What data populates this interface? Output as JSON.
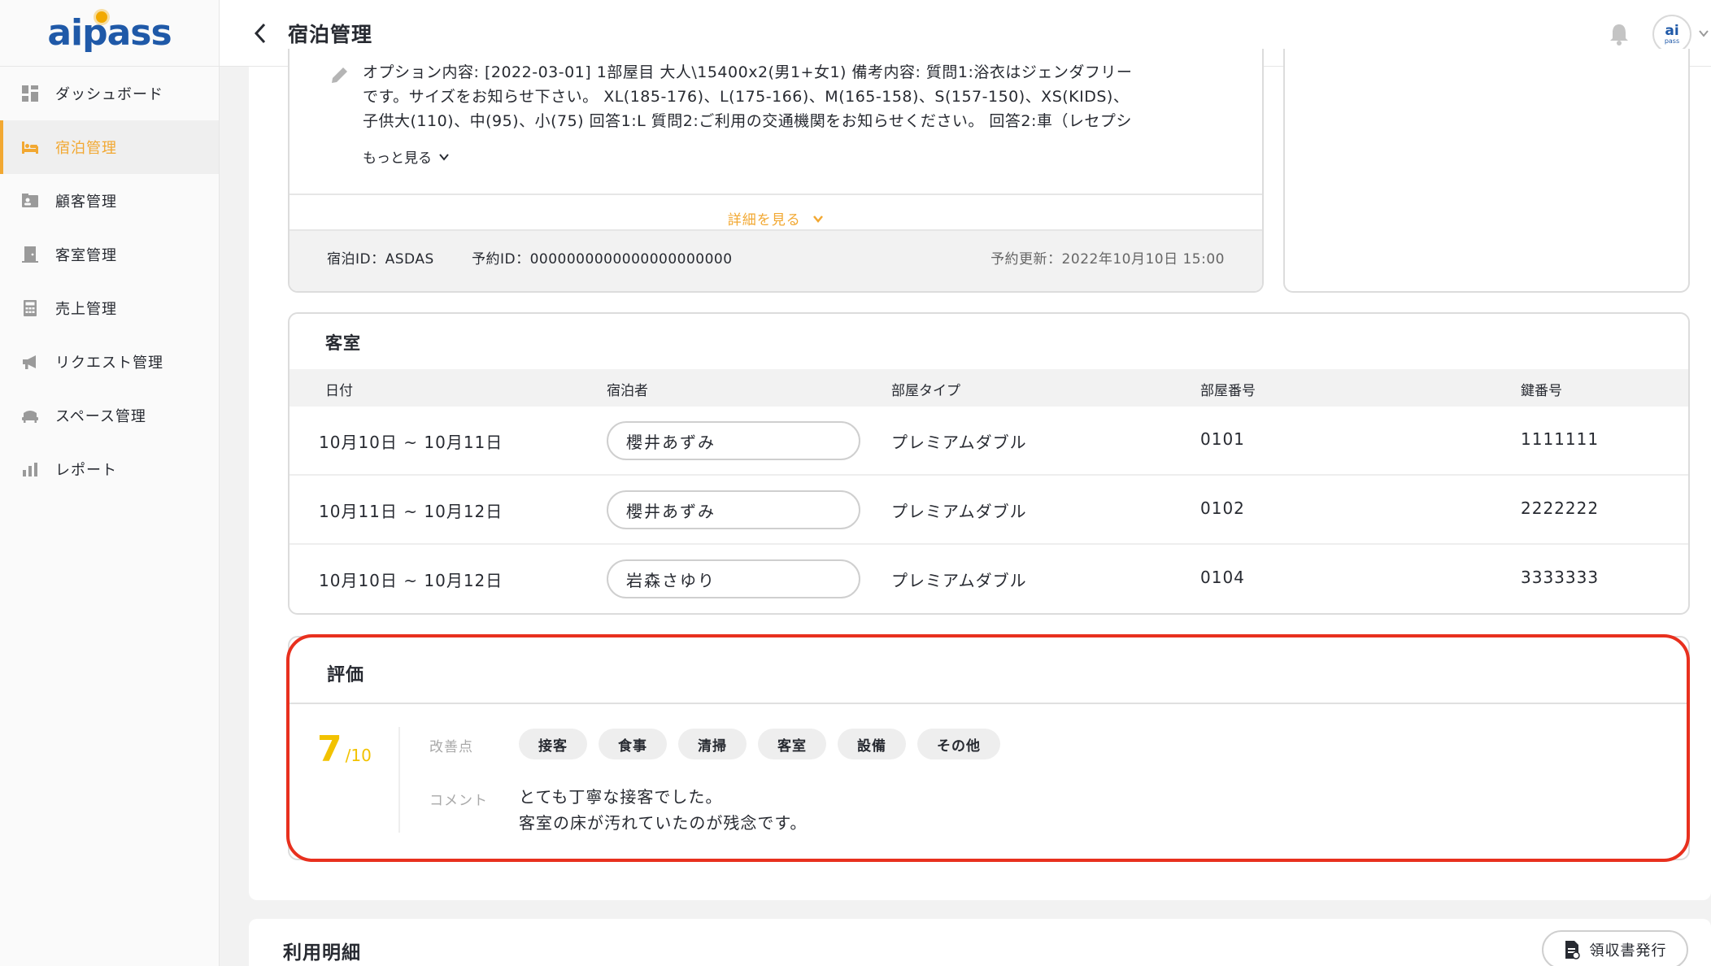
{
  "app": {
    "logo_text": "aipass"
  },
  "sidebar": {
    "items": [
      {
        "label": "ダッシュボード",
        "icon": "dashboard-icon"
      },
      {
        "label": "宿泊管理",
        "icon": "bed-icon",
        "active": true
      },
      {
        "label": "顧客管理",
        "icon": "customer-card-icon"
      },
      {
        "label": "客室管理",
        "icon": "door-icon"
      },
      {
        "label": "売上管理",
        "icon": "calculator-icon"
      },
      {
        "label": "リクエスト管理",
        "icon": "megaphone-icon"
      },
      {
        "label": "スペース管理",
        "icon": "space-icon"
      },
      {
        "label": "レポート",
        "icon": "bar-chart-icon"
      }
    ]
  },
  "header": {
    "title": "宿泊管理",
    "avatar_top": "ai",
    "avatar_bottom": "pass"
  },
  "reservation": {
    "memo_lines": [
      "オプション内容: [2022-03-01] 1部屋目 大人\\15400x2(男1+女1) 備考内容: 質問1:浴衣はジェンダフリー",
      "です。サイズをお知らせ下さい。 XL(185-176)、L(175-166)、M(165-158)、S(157-150)、XS(KIDS)、",
      "子供大(110)、中(95)、小(75) 回答1:L 質問2:ご利用の交通機関をお知らせください。 回答2:車（レセプシ"
    ],
    "more_label": "もっと見る",
    "detail_label": "詳細を見る",
    "stay_id": "宿泊ID：ASDAS",
    "reserve_id": "予約ID：0000000000000000000000",
    "updated": "予約更新：2022年10月10日 15:00"
  },
  "rooms": {
    "title": "客室",
    "columns": [
      "日付",
      "宿泊者",
      "部屋タイプ",
      "部屋番号",
      "鍵番号"
    ],
    "rows": [
      {
        "date": "10月10日 ~ 10月11日",
        "guest": "櫻井あずみ",
        "type": "プレミアムダブル",
        "room": "0101",
        "key": "1111111"
      },
      {
        "date": "10月11日 ~ 10月12日",
        "guest": "櫻井あずみ",
        "type": "プレミアムダブル",
        "room": "0102",
        "key": "2222222"
      },
      {
        "date": "10月10日 ~ 10月12日",
        "guest": "岩森さゆり",
        "type": "プレミアムダブル",
        "room": "0104",
        "key": "3333333"
      }
    ]
  },
  "rating": {
    "title": "評価",
    "score": "7",
    "score_max": "/10",
    "improve_label": "改善点",
    "tags": [
      "接客",
      "食事",
      "清掃",
      "客室",
      "設備",
      "その他"
    ],
    "comment_label": "コメント",
    "comment_lines": [
      "とても丁寧な接客でした。",
      "客室の床が汚れていたのが残念です。"
    ]
  },
  "usage": {
    "title": "利用明細",
    "receipt_label": "領収書発行"
  },
  "colors": {
    "accent": "#f2a832",
    "brand": "#1f59a8",
    "score": "#f2c200",
    "highlight": "#e8301e"
  }
}
